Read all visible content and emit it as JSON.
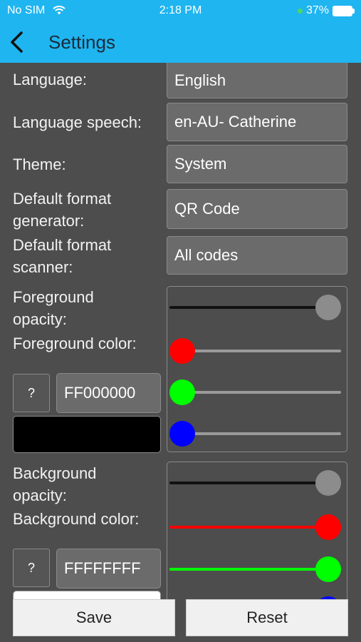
{
  "status_bar": {
    "carrier": "No SIM",
    "time": "2:18 PM",
    "battery": "37%"
  },
  "nav": {
    "title": "Settings"
  },
  "settings": {
    "language": {
      "label": "Language:",
      "value": "English"
    },
    "speech": {
      "label": "Language speech:",
      "value": "en-AU- Catherine"
    },
    "theme": {
      "label": "Theme:",
      "value": "System"
    },
    "generator": {
      "label_1": "Default format",
      "label_2": "generator:",
      "value": "QR Code"
    },
    "scanner": {
      "label_1": "Default format",
      "label_2": "scanner:",
      "value": "All codes"
    }
  },
  "foreground": {
    "opacity_label_1": "Foreground",
    "opacity_label_2": "opacity:",
    "color_label": "Foreground color:",
    "help": "?",
    "hex": "FF000000",
    "swatch_color": "#000000",
    "sliders": {
      "opacity": 1.0,
      "red": 0.0,
      "green": 0.0,
      "blue": 0.0
    }
  },
  "background": {
    "opacity_label_1": "Background",
    "opacity_label_2": "opacity:",
    "color_label": "Background color:",
    "help": "?",
    "hex": "FFFFFFFF",
    "swatch_color": "#ffffff",
    "sliders": {
      "opacity": 1.0,
      "red": 1.0,
      "green": 1.0,
      "blue": 1.0
    }
  },
  "colors": {
    "accent": "#1fb5f0",
    "red": "#ff0000",
    "green": "#00ff00",
    "blue": "#0000ff",
    "opacity_thumb": "#8c8c8c"
  },
  "buttons": {
    "save": "Save",
    "reset": "Reset"
  }
}
